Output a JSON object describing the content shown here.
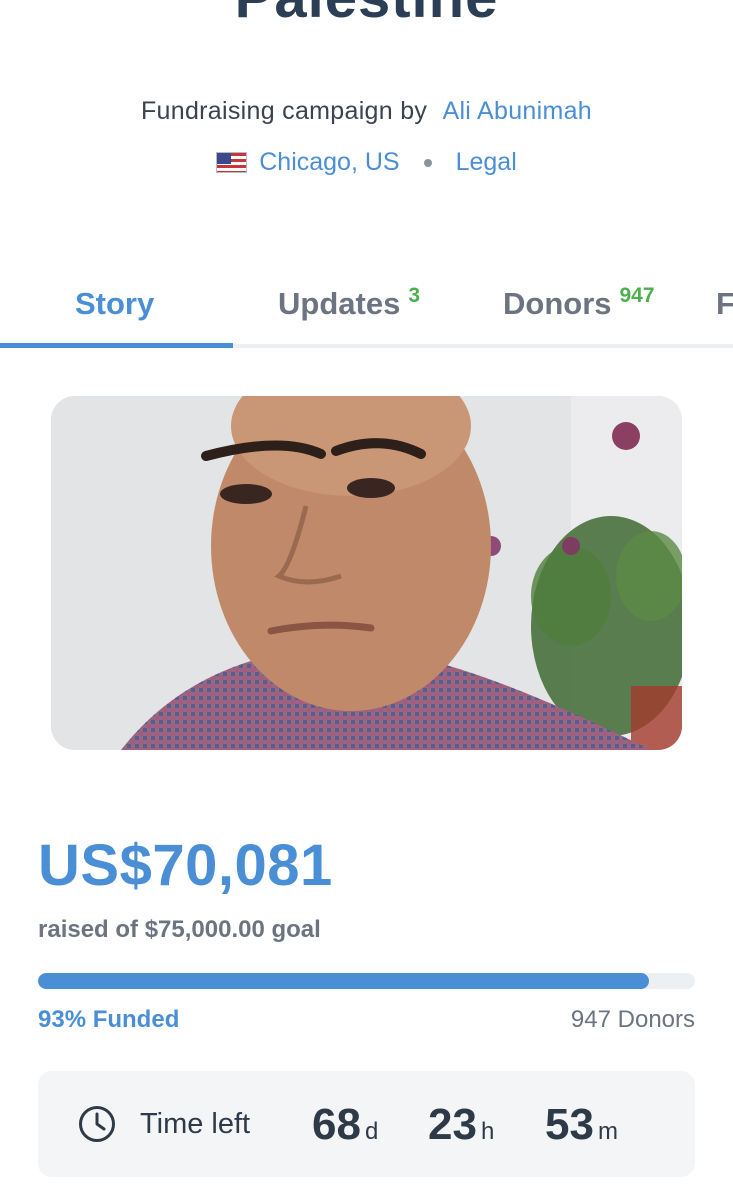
{
  "campaign": {
    "title": "Palestine",
    "byline_prefix": "Fundraising campaign by",
    "organizer": "Ali Abunimah",
    "location": "Chicago, US",
    "category": "Legal",
    "flag_icon": "us-flag-icon"
  },
  "tabs": [
    {
      "label": "Story",
      "badge": "",
      "active": true
    },
    {
      "label": "Updates",
      "badge": "3",
      "active": false
    },
    {
      "label": "Donors",
      "badge": "947",
      "active": false
    },
    {
      "label": "F",
      "badge": "",
      "active": false
    }
  ],
  "fundraising": {
    "amount_raised": "US$70,081",
    "goal_text": "raised of $75,000.00 goal",
    "progress_fraction": 0.93,
    "funded_label": "93% Funded",
    "donors_label": "947 Donors"
  },
  "time_left": {
    "label": "Time left",
    "days": "68",
    "days_unit": "d",
    "hours": "23",
    "hours_unit": "h",
    "minutes": "53",
    "minutes_unit": "m",
    "icon": "clock-icon"
  },
  "colors": {
    "accent": "#4a8fd6",
    "badge_green": "#4cb04c",
    "title": "#2c3e55"
  }
}
